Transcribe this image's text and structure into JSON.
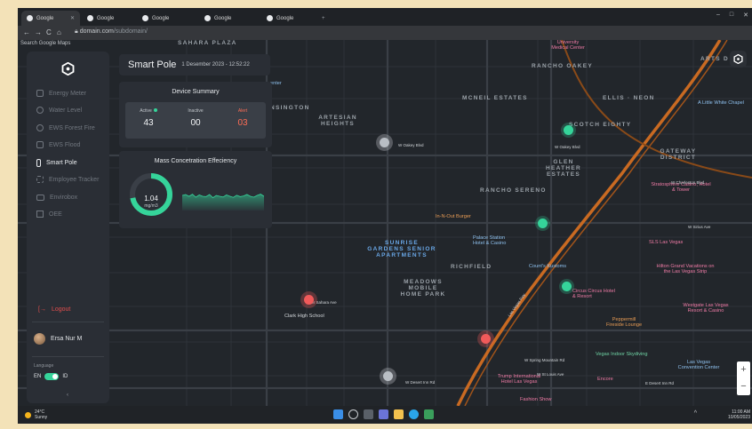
{
  "browser": {
    "tabs": [
      {
        "label": "Google",
        "active": true
      },
      {
        "label": "Google",
        "active": false
      },
      {
        "label": "Google",
        "active": false
      },
      {
        "label": "Google",
        "active": false
      },
      {
        "label": "Google",
        "active": false
      }
    ],
    "url_domain": "domain.com",
    "url_path": "/subdomain/",
    "nav": {
      "back": "←",
      "forward": "→",
      "reload": "C",
      "home": "⌂"
    },
    "window_controls": {
      "minimize": "–",
      "maximize": "□",
      "close": "✕"
    },
    "new_tab": "+"
  },
  "map": {
    "search_placeholder": "Search Google Maps",
    "zoom_in": "+",
    "zoom_out": "−",
    "area_labels": {
      "sahara_plaza": "SAHARA PLAZA",
      "rancho_oakey": "RANCHO OAKEY",
      "arts_district": "ARTS D",
      "mcneil_estates": "MCNEIL ESTATES",
      "ellis_neon": "ELLIS · NEON",
      "scotch_eighty": "SCOTCH EIGHTY",
      "artesian_heights": "ARTESIAN HEIGHTS",
      "huntington": "NSINGTON",
      "glen_heather": "GLEN HEATHER ESTATES",
      "gateway": "GATEWAY DISTRICT",
      "rancho_sereno": "RANCHO SERENO",
      "sunrise_gardens": "SUNRISE GARDENS SENIOR APARTMENTS",
      "richfield": "RICHFIELD",
      "meadows": "MEADOWS MOBILE HOME PARK"
    },
    "places": {
      "university_medical": "University Medical Center",
      "little_white_chapel": "A Little White Chapel",
      "stratosphere": "Stratosphere Casino, Hotel & Tower",
      "in_n_out": "In-N-Out Burger",
      "palace_station": "Palace Station Hotel & Casino",
      "sls": "SLS Las Vegas",
      "countys_kustoms": "Count's Kustoms",
      "hilton_grand": "Hilton Grand Vacations on the Las Vegas Strip",
      "circus_circus": "Circus Circus Hotel & Resort",
      "westgate": "Westgate Las Vegas Resort & Casino",
      "clark_high": "Clark High School",
      "peppermill": "Peppermill Fireside Lounge",
      "vegas_indoor": "Vegas Indoor Skydiving",
      "convention_center": "Las Vegas Convention Center",
      "trump": "Trump International Hotel Las Vegas",
      "encore": "Encore",
      "fashion_show": "Fashion Show",
      "center": "enter"
    },
    "streets": {
      "w_oakey": "W Oakey Blvd",
      "w_charleston": "W Charleston Blvd",
      "w_sahara": "W Sahara Ave",
      "w_desert_inn": "W Desert Inn Rd",
      "w_spring_mtn": "W Spring Mountain Rd",
      "las_vegas_fwy": "Las Vegas Fwy",
      "valley_view": "S Valley View Blvd",
      "rancho_dr": "Rancho Dr",
      "industrial": "Industrial Rd",
      "e_desert_inn": "E Desert Inn Rd",
      "s_maryland": "S Maryland Pkwy",
      "w_st_louis": "W St Louis Ave",
      "w_sirius": "W Sirius Ave",
      "w_meadows": "Western Ave"
    }
  },
  "sidebar": {
    "items": [
      {
        "label": "Energy Meter",
        "icon": "energy-meter-icon",
        "active": false
      },
      {
        "label": "Water Level",
        "icon": "water-drop-icon",
        "active": false
      },
      {
        "label": "EWS Forest Fire",
        "icon": "fire-icon",
        "active": false
      },
      {
        "label": "EWS Flood",
        "icon": "flood-icon",
        "active": false
      },
      {
        "label": "Smart Pole",
        "icon": "smart-pole-icon",
        "active": true
      },
      {
        "label": "Employee Tracker",
        "icon": "tracker-icon",
        "active": false
      },
      {
        "label": "Envirobox",
        "icon": "monitor-icon",
        "active": false
      },
      {
        "label": "OEE",
        "icon": "grid-icon",
        "active": false
      }
    ],
    "logout": "Logout",
    "user_name": "Ersa Nur M",
    "language_label": "Language",
    "lang_left": "EN",
    "lang_right": "ID",
    "collapse": "‹"
  },
  "header": {
    "title": "Smart Pole",
    "datetime": "1 Desember 2023 - 12:52:22"
  },
  "device_summary": {
    "title": "Device Summary",
    "active_label": "Active",
    "active_value": "43",
    "inactive_label": "Inactive",
    "inactive_value": "00",
    "alert_label": "Alert",
    "alert_value": "03"
  },
  "mass": {
    "title": "Mass Concetration Effeciency",
    "value": "1.04",
    "unit": "mg/m3",
    "gauge_fraction": 0.72,
    "sparkline": [
      0.55,
      0.6,
      0.5,
      0.62,
      0.45,
      0.58,
      0.5,
      0.48,
      0.6,
      0.42,
      0.55,
      0.5,
      0.46,
      0.58,
      0.5,
      0.44,
      0.56,
      0.48,
      0.52,
      0.6,
      0.5,
      0.45,
      0.55,
      0.62,
      0.5
    ]
  },
  "colors": {
    "accent_green": "#35d49a",
    "alert_red": "#ff6d55",
    "marker_red": "#f05a5a",
    "freeway_orange": "#c96a22"
  },
  "taskbar": {
    "temperature": "24°C",
    "weather": "Sunny",
    "time": "11:00 AM",
    "date": "10/05/2023",
    "tray_caret": "^"
  }
}
